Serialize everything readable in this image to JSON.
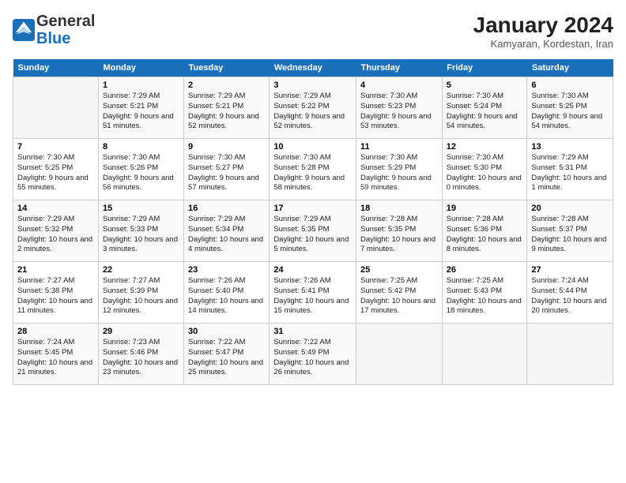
{
  "header": {
    "logo_general": "General",
    "logo_blue": "Blue",
    "month_year": "January 2024",
    "location": "Kamyaran, Kordestan, Iran"
  },
  "weekdays": [
    "Sunday",
    "Monday",
    "Tuesday",
    "Wednesday",
    "Thursday",
    "Friday",
    "Saturday"
  ],
  "weeks": [
    [
      {
        "day": "",
        "sunrise": "",
        "sunset": "",
        "daylight": ""
      },
      {
        "day": "1",
        "sunrise": "Sunrise: 7:29 AM",
        "sunset": "Sunset: 5:21 PM",
        "daylight": "Daylight: 9 hours and 51 minutes."
      },
      {
        "day": "2",
        "sunrise": "Sunrise: 7:29 AM",
        "sunset": "Sunset: 5:21 PM",
        "daylight": "Daylight: 9 hours and 52 minutes."
      },
      {
        "day": "3",
        "sunrise": "Sunrise: 7:29 AM",
        "sunset": "Sunset: 5:22 PM",
        "daylight": "Daylight: 9 hours and 52 minutes."
      },
      {
        "day": "4",
        "sunrise": "Sunrise: 7:30 AM",
        "sunset": "Sunset: 5:23 PM",
        "daylight": "Daylight: 9 hours and 53 minutes."
      },
      {
        "day": "5",
        "sunrise": "Sunrise: 7:30 AM",
        "sunset": "Sunset: 5:24 PM",
        "daylight": "Daylight: 9 hours and 54 minutes."
      },
      {
        "day": "6",
        "sunrise": "Sunrise: 7:30 AM",
        "sunset": "Sunset: 5:25 PM",
        "daylight": "Daylight: 9 hours and 54 minutes."
      }
    ],
    [
      {
        "day": "7",
        "sunrise": "Sunrise: 7:30 AM",
        "sunset": "Sunset: 5:25 PM",
        "daylight": "Daylight: 9 hours and 55 minutes."
      },
      {
        "day": "8",
        "sunrise": "Sunrise: 7:30 AM",
        "sunset": "Sunset: 5:26 PM",
        "daylight": "Daylight: 9 hours and 56 minutes."
      },
      {
        "day": "9",
        "sunrise": "Sunrise: 7:30 AM",
        "sunset": "Sunset: 5:27 PM",
        "daylight": "Daylight: 9 hours and 57 minutes."
      },
      {
        "day": "10",
        "sunrise": "Sunrise: 7:30 AM",
        "sunset": "Sunset: 5:28 PM",
        "daylight": "Daylight: 9 hours and 58 minutes."
      },
      {
        "day": "11",
        "sunrise": "Sunrise: 7:30 AM",
        "sunset": "Sunset: 5:29 PM",
        "daylight": "Daylight: 9 hours and 59 minutes."
      },
      {
        "day": "12",
        "sunrise": "Sunrise: 7:30 AM",
        "sunset": "Sunset: 5:30 PM",
        "daylight": "Daylight: 10 hours and 0 minutes."
      },
      {
        "day": "13",
        "sunrise": "Sunrise: 7:29 AM",
        "sunset": "Sunset: 5:31 PM",
        "daylight": "Daylight: 10 hours and 1 minute."
      }
    ],
    [
      {
        "day": "14",
        "sunrise": "Sunrise: 7:29 AM",
        "sunset": "Sunset: 5:32 PM",
        "daylight": "Daylight: 10 hours and 2 minutes."
      },
      {
        "day": "15",
        "sunrise": "Sunrise: 7:29 AM",
        "sunset": "Sunset: 5:33 PM",
        "daylight": "Daylight: 10 hours and 3 minutes."
      },
      {
        "day": "16",
        "sunrise": "Sunrise: 7:29 AM",
        "sunset": "Sunset: 5:34 PM",
        "daylight": "Daylight: 10 hours and 4 minutes."
      },
      {
        "day": "17",
        "sunrise": "Sunrise: 7:29 AM",
        "sunset": "Sunset: 5:35 PM",
        "daylight": "Daylight: 10 hours and 5 minutes."
      },
      {
        "day": "18",
        "sunrise": "Sunrise: 7:28 AM",
        "sunset": "Sunset: 5:35 PM",
        "daylight": "Daylight: 10 hours and 7 minutes."
      },
      {
        "day": "19",
        "sunrise": "Sunrise: 7:28 AM",
        "sunset": "Sunset: 5:36 PM",
        "daylight": "Daylight: 10 hours and 8 minutes."
      },
      {
        "day": "20",
        "sunrise": "Sunrise: 7:28 AM",
        "sunset": "Sunset: 5:37 PM",
        "daylight": "Daylight: 10 hours and 9 minutes."
      }
    ],
    [
      {
        "day": "21",
        "sunrise": "Sunrise: 7:27 AM",
        "sunset": "Sunset: 5:38 PM",
        "daylight": "Daylight: 10 hours and 11 minutes."
      },
      {
        "day": "22",
        "sunrise": "Sunrise: 7:27 AM",
        "sunset": "Sunset: 5:39 PM",
        "daylight": "Daylight: 10 hours and 12 minutes."
      },
      {
        "day": "23",
        "sunrise": "Sunrise: 7:26 AM",
        "sunset": "Sunset: 5:40 PM",
        "daylight": "Daylight: 10 hours and 14 minutes."
      },
      {
        "day": "24",
        "sunrise": "Sunrise: 7:26 AM",
        "sunset": "Sunset: 5:41 PM",
        "daylight": "Daylight: 10 hours and 15 minutes."
      },
      {
        "day": "25",
        "sunrise": "Sunrise: 7:25 AM",
        "sunset": "Sunset: 5:42 PM",
        "daylight": "Daylight: 10 hours and 17 minutes."
      },
      {
        "day": "26",
        "sunrise": "Sunrise: 7:25 AM",
        "sunset": "Sunset: 5:43 PM",
        "daylight": "Daylight: 10 hours and 18 minutes."
      },
      {
        "day": "27",
        "sunrise": "Sunrise: 7:24 AM",
        "sunset": "Sunset: 5:44 PM",
        "daylight": "Daylight: 10 hours and 20 minutes."
      }
    ],
    [
      {
        "day": "28",
        "sunrise": "Sunrise: 7:24 AM",
        "sunset": "Sunset: 5:45 PM",
        "daylight": "Daylight: 10 hours and 21 minutes."
      },
      {
        "day": "29",
        "sunrise": "Sunrise: 7:23 AM",
        "sunset": "Sunset: 5:46 PM",
        "daylight": "Daylight: 10 hours and 23 minutes."
      },
      {
        "day": "30",
        "sunrise": "Sunrise: 7:22 AM",
        "sunset": "Sunset: 5:47 PM",
        "daylight": "Daylight: 10 hours and 25 minutes."
      },
      {
        "day": "31",
        "sunrise": "Sunrise: 7:22 AM",
        "sunset": "Sunset: 5:49 PM",
        "daylight": "Daylight: 10 hours and 26 minutes."
      },
      {
        "day": "",
        "sunrise": "",
        "sunset": "",
        "daylight": ""
      },
      {
        "day": "",
        "sunrise": "",
        "sunset": "",
        "daylight": ""
      },
      {
        "day": "",
        "sunrise": "",
        "sunset": "",
        "daylight": ""
      }
    ]
  ]
}
